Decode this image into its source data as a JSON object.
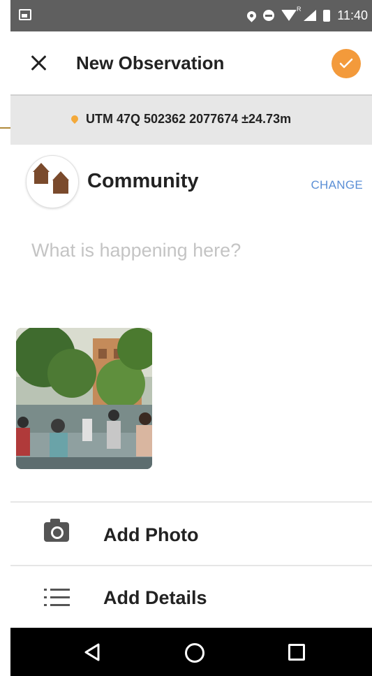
{
  "status_bar": {
    "time": "11:40",
    "icons": [
      "screenshot-icon",
      "location-icon",
      "dnd-icon",
      "wifi-icon",
      "signal-icon",
      "battery-icon"
    ],
    "roaming": "R"
  },
  "toolbar": {
    "title": "New Observation",
    "close_icon": "close-icon",
    "confirm_icon": "check-icon",
    "confirm_color": "#f39a3b"
  },
  "location": {
    "text": "UTM 47Q 502362 2077674 ±24.73m",
    "icon": "pin-icon",
    "icon_color": "#f4a93a"
  },
  "category": {
    "name": "Community",
    "change_label": "CHANGE",
    "icon": "houses-icon",
    "icon_color": "#7a4a2c"
  },
  "description": {
    "placeholder": "What is happening here?",
    "value": ""
  },
  "photos": [
    {
      "name": "street-scene-photo"
    }
  ],
  "actions": {
    "add_photo_label": "Add Photo",
    "add_details_label": "Add Details"
  },
  "nav": {
    "back": "back-icon",
    "home": "home-icon",
    "recents": "recents-icon"
  },
  "colors": {
    "accent": "#f39a3b",
    "link": "#5b8fd6",
    "status_bar": "#5f5f5f",
    "location_bar": "#e7e7e7"
  }
}
